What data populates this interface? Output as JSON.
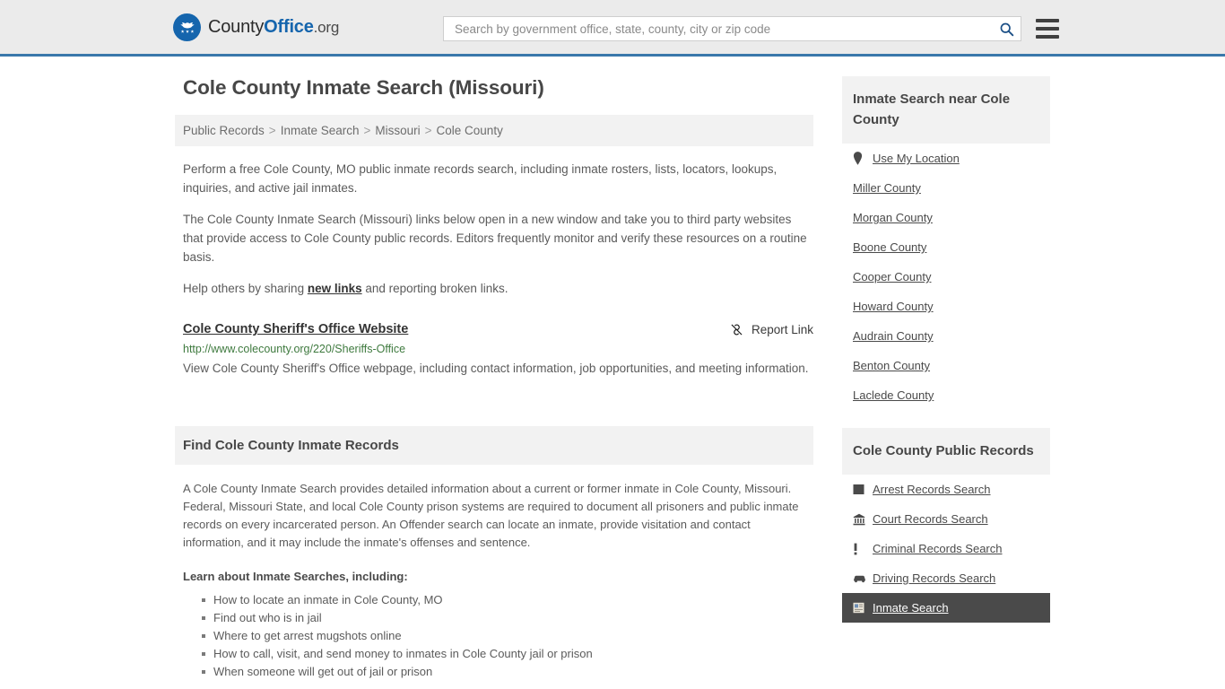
{
  "header": {
    "logo": {
      "text_part1": "County",
      "text_part2": "Office",
      "text_part3": ".org",
      "icon": "eagle-stars-logo-icon"
    },
    "search": {
      "placeholder": "Search by government office, state, county, city or zip code",
      "value": "",
      "icon": "search-icon"
    },
    "menu_icon": "hamburger-menu-icon"
  },
  "page_title": "Cole County Inmate Search (Missouri)",
  "breadcrumb": {
    "items": [
      "Public Records",
      "Inmate Search",
      "Missouri",
      "Cole County"
    ],
    "separator": ">"
  },
  "intro": {
    "paragraph1": "Perform a free Cole County, MO public inmate records search, including inmate rosters, lists, locators, lookups, inquiries, and active jail inmates.",
    "paragraph2": "The Cole County Inmate Search (Missouri) links below open in a new window and take you to third party websites that provide access to Cole County public records. Editors frequently monitor and verify these resources on a routine basis.",
    "paragraph3_before": "Help others by sharing ",
    "paragraph3_link": "new links",
    "paragraph3_after": " and reporting broken links."
  },
  "result": {
    "title": "Cole County Sheriff's Office Website",
    "url": "http://www.colecounty.org/220/Sheriffs-Office",
    "description": "View Cole County Sheriff's Office webpage, including contact information, job opportunities, and meeting information.",
    "report_label": "Report Link",
    "report_icon": "broken-link-icon"
  },
  "section": {
    "heading": "Find Cole County Inmate Records",
    "body": "A Cole County Inmate Search provides detailed information about a current or former inmate in Cole County, Missouri. Federal, Missouri State, and local Cole County prison systems are required to document all prisoners and public inmate records on every incarcerated person. An Offender search can locate an inmate, provide visitation and contact information, and it may include the inmate's offenses and sentence.",
    "learn_title": "Learn about Inmate Searches, including:",
    "learn_items": [
      "How to locate an inmate in Cole County, MO",
      "Find out who is in jail",
      "Where to get arrest mugshots online",
      "How to call, visit, and send money to inmates in Cole County jail or prison",
      "When someone will get out of jail or prison"
    ]
  },
  "sidebar": {
    "nearby": {
      "heading": "Inmate Search near Cole County",
      "items": [
        {
          "label": "Use My Location",
          "icon": "map-pin-icon"
        },
        {
          "label": "Miller County",
          "icon": null
        },
        {
          "label": "Morgan County",
          "icon": null
        },
        {
          "label": "Boone County",
          "icon": null
        },
        {
          "label": "Cooper County",
          "icon": null
        },
        {
          "label": "Howard County",
          "icon": null
        },
        {
          "label": "Audrain County",
          "icon": null
        },
        {
          "label": "Benton County",
          "icon": null
        },
        {
          "label": "Laclede County",
          "icon": null
        }
      ]
    },
    "public_records": {
      "heading": "Cole County Public Records",
      "items": [
        {
          "label": "Arrest Records Search",
          "icon": "fingerprint-card-icon",
          "active": false
        },
        {
          "label": "Court Records Search",
          "icon": "courthouse-icon",
          "active": false
        },
        {
          "label": "Criminal Records Search",
          "icon": "exclamation-icon",
          "active": false
        },
        {
          "label": "Driving Records Search",
          "icon": "car-icon",
          "active": false
        },
        {
          "label": "Inmate Search",
          "icon": "id-card-icon",
          "active": true
        }
      ]
    }
  },
  "colors": {
    "header_bg": "#ebebeb",
    "header_border": "#3a78ab",
    "brand_blue": "#1565ad",
    "panel_bg": "#f2f2f2",
    "url_green": "#3f7a3f",
    "active_bg": "#4a4a4a",
    "text": "#5b5b5b"
  }
}
